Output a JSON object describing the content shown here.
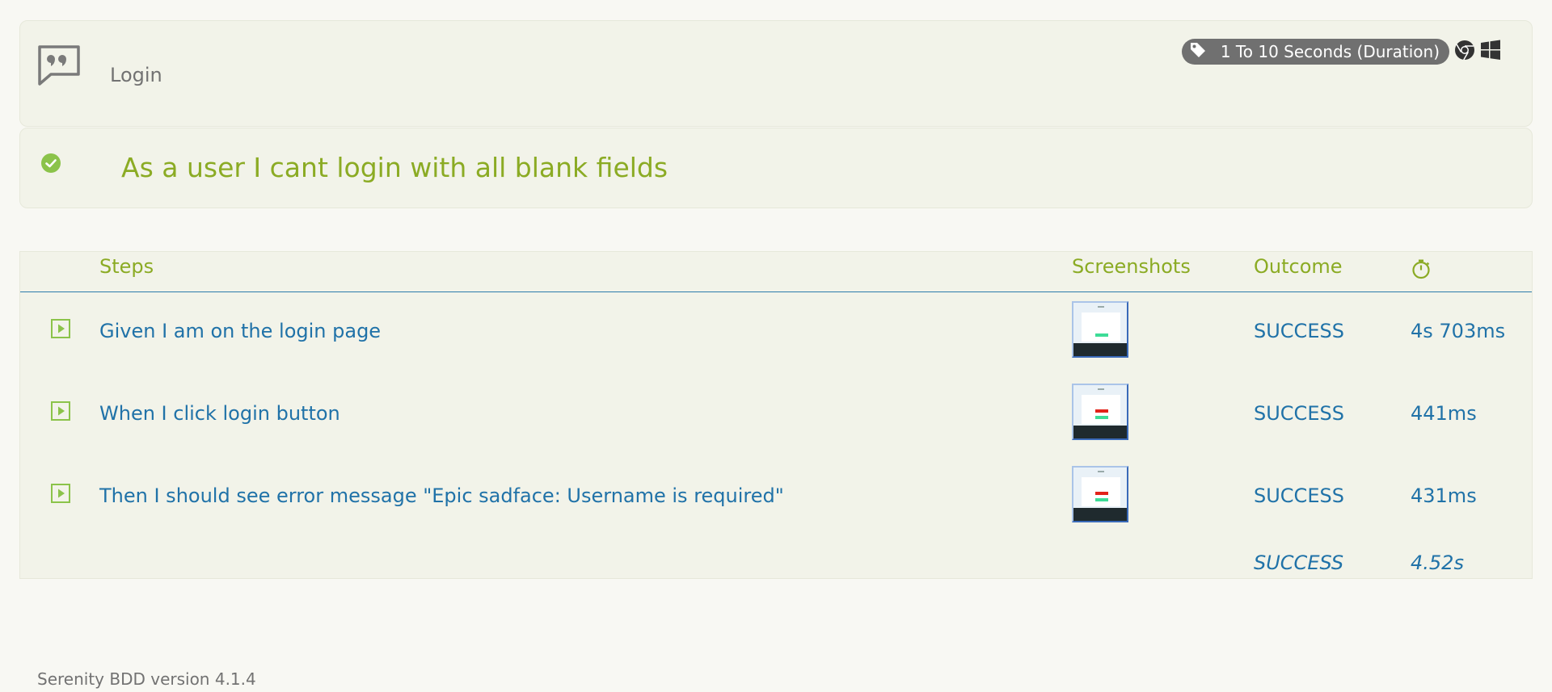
{
  "feature": {
    "title": "Login",
    "tag": "1 To 10 Seconds (Duration)",
    "tag_icon": "tag-icon",
    "browser_icon": "chrome-icon",
    "os_icon": "windows-icon"
  },
  "scenario": {
    "title": "As a user I cant login with all blank fields",
    "status_icon": "check-circle-icon"
  },
  "table": {
    "headers": {
      "steps": "Steps",
      "screenshots": "Screenshots",
      "outcome": "Outcome",
      "duration_icon": "stopwatch-icon"
    },
    "rows": [
      {
        "step": "Given I am on the login page",
        "outcome": "SUCCESS",
        "duration": "4s 703ms",
        "screenshot": "login-page",
        "error_banner": false
      },
      {
        "step": "When I click login button",
        "outcome": "SUCCESS",
        "duration": "441ms",
        "screenshot": "error-banner",
        "error_banner": true
      },
      {
        "step": "Then I should see error message \"Epic sadface: Username is required\"",
        "outcome": "SUCCESS",
        "duration": "431ms",
        "screenshot": "error-banner",
        "error_banner": true
      }
    ],
    "total": {
      "outcome": "SUCCESS",
      "duration": "4.52s"
    }
  },
  "footer": {
    "version": "Serenity BDD version 4.1.4"
  },
  "colors": {
    "accent_green": "#8bab24",
    "link_blue": "#2072a8",
    "panel_bg": "#f2f3e9",
    "tag_bg": "#707070"
  }
}
